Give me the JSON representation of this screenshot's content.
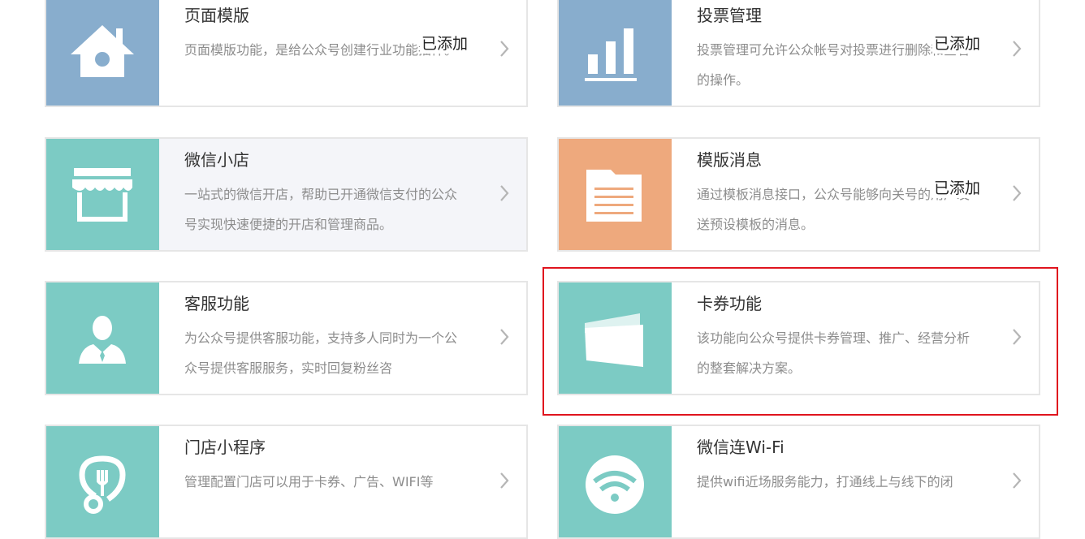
{
  "colors": {
    "blue": "#88adcd",
    "teal": "#7ccbc4",
    "orange": "#eea97d",
    "highlight": "#e0141e"
  },
  "plugins": [
    {
      "title": "页面模版",
      "desc": "页面模版功能，是给公众号创建行业功能插件。",
      "status": "已添加",
      "icon": "house-icon",
      "color": "blue"
    },
    {
      "title": "投票管理",
      "desc": "投票管理可允许公众帐号对投票进行删除和查看的操作。",
      "status": "已添加",
      "icon": "bar-chart-icon",
      "color": "blue"
    },
    {
      "title": "微信小店",
      "desc": "一站式的微信开店，帮助已开通微信支付的公众号实现快速便捷的开店和管理商品。",
      "status": "",
      "icon": "store-icon",
      "color": "teal"
    },
    {
      "title": "模版消息",
      "desc": "通过模板消息接口，公众号能够向关号的用户发送预设模板的消息。",
      "status": "已添加",
      "icon": "document-icon",
      "color": "orange"
    },
    {
      "title": "客服功能",
      "desc": "为公众号提供客服功能，支持多人同时为一个公众号提供客服服务，实时回复粉丝咨",
      "status": "",
      "icon": "service-person-icon",
      "color": "teal"
    },
    {
      "title": "卡券功能",
      "desc": "该功能向公众号提供卡券管理、推广、经营分析的整套解决方案。",
      "status": "",
      "icon": "card-icon",
      "color": "teal"
    },
    {
      "title": "门店小程序",
      "desc": "管理配置门店可以用于卡券、广告、WIFI等",
      "status": "",
      "icon": "store-pin-icon",
      "color": "teal"
    },
    {
      "title": "微信连Wi-Fi",
      "desc": "提供wifi近场服务能力，打通线上与线下的闭",
      "status": "",
      "icon": "wifi-icon",
      "color": "teal"
    }
  ]
}
